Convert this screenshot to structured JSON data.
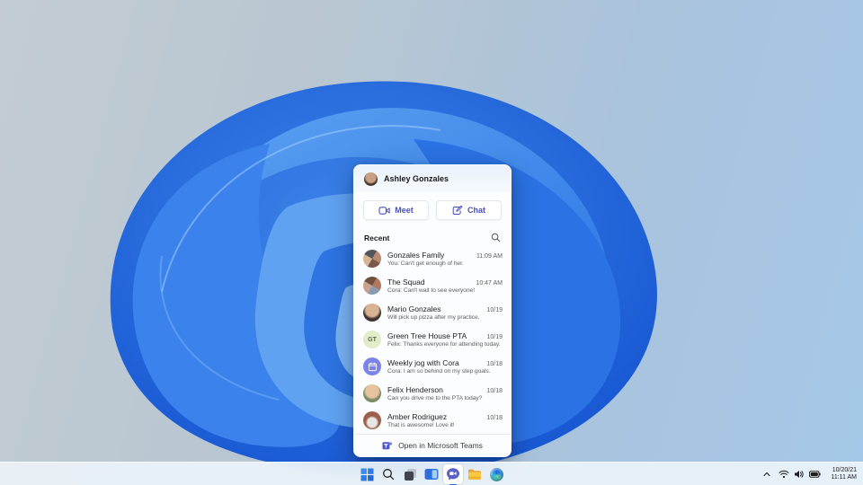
{
  "flyout": {
    "header": {
      "name": "Ashley Gonzales"
    },
    "actions": {
      "meet_label": "Meet",
      "chat_label": "Chat"
    },
    "recent_label": "Recent",
    "conversations": [
      {
        "title": "Gonzales Family",
        "preview": "You: Can't get enough of her.",
        "time": "11:09 AM"
      },
      {
        "title": "The Squad",
        "preview": "Cora: Can't wait to see everyone!",
        "time": "10:47 AM"
      },
      {
        "title": "Mario Gonzales",
        "preview": "Will pick up pizza after my practice.",
        "time": "10/19"
      },
      {
        "title": "Green Tree House PTA",
        "preview": "Felix: Thanks everyone for attending today.",
        "time": "10/19",
        "initials": "GT"
      },
      {
        "title": "Weekly jog with Cora",
        "preview": "Cora: I am so behind on my step goals.",
        "time": "10/18"
      },
      {
        "title": "Felix Henderson",
        "preview": "Can you drive me to the PTA today?",
        "time": "10/18"
      },
      {
        "title": "Amber Rodriguez",
        "preview": "That is awesome! Love it!",
        "time": "10/18"
      }
    ],
    "footer": {
      "open_label": "Open in Microsoft Teams"
    }
  },
  "taskbar": {
    "buttons": [
      "start",
      "search",
      "task-view",
      "widgets",
      "chat",
      "file-explorer",
      "edge"
    ],
    "active_button": "chat",
    "tray": {
      "date": "10/20/21",
      "time": "11:11 AM"
    }
  },
  "colors": {
    "accent": "#2b6de0",
    "teams_purple": "#5b60c9",
    "taskbar_bg": "#ebf3f9"
  }
}
